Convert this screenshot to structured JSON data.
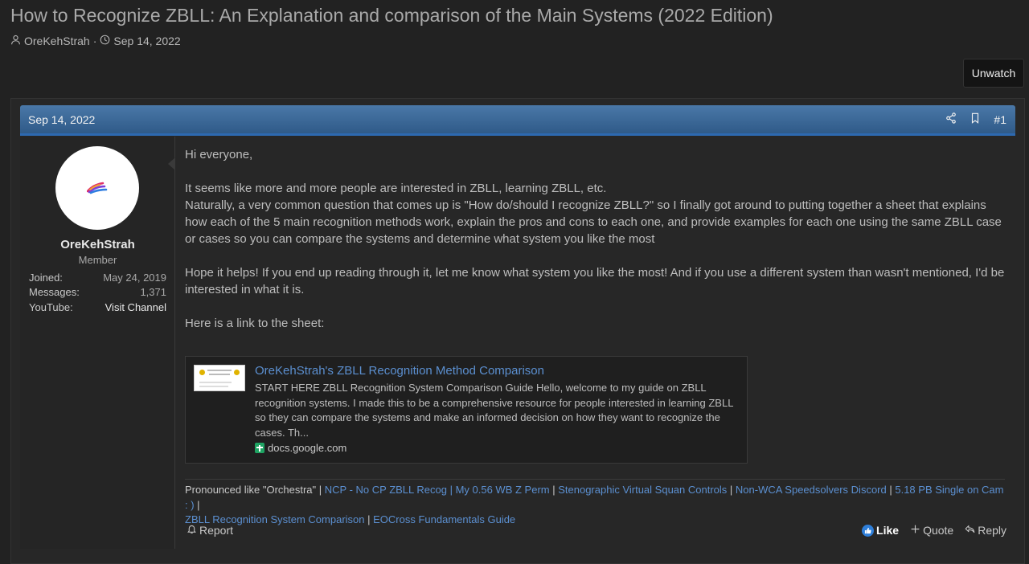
{
  "thread": {
    "title": "How to Recognize ZBLL: An Explanation and comparison of the Main Systems (2022 Edition)",
    "author": "OreKehStrah",
    "separator": "·",
    "date": "Sep 14, 2022",
    "unwatch_label": "Unwatch"
  },
  "post": {
    "date": "Sep 14, 2022",
    "number": "#1",
    "paragraphs": [
      "Hi everyone,",
      "It seems like more and more people are interested in ZBLL, learning ZBLL, etc.",
      "Naturally, a very common question that comes up is \"How do/should I recognize ZBLL?\" so I finally got around to putting together a sheet that explains how each of the 5 main recognition methods work, explain the pros and cons to each one, and provide examples for each one using the same ZBLL case or cases so you can compare the systems and determine what system you like the most",
      "Hope it helps! If you end up reading through it, let me know what system you like the most! And if you use a different system than wasn't mentioned, I'd be interested in what it is.",
      "Here is a link to the sheet:"
    ],
    "unfurl": {
      "title": "OreKehStrah's ZBLL Recognition Method Comparison",
      "description": "START HERE ZBLL Recognition System Comparison Guide Hello, welcome to my guide on ZBLL recognition systems. I made this to be a comprehensive resource for people interested in learning ZBLL so they can compare the systems and make an informed decision on how they want to recognize the cases. Th...",
      "domain": "docs.google.com"
    },
    "signature": {
      "lead": "Pronounced like \"Orchestra\"",
      "sep": " | ",
      "links": [
        "NCP - No CP ZBLL Recog | My 0.56 WB Z Perm",
        "Stenographic Virtual Squan Controls",
        "Non-WCA Speedsolvers Discord",
        "5.18 PB Single on Cam : )",
        "ZBLL Recognition System Comparison",
        "EOCross Fundamentals Guide"
      ]
    },
    "actions": {
      "report": "Report",
      "like": "Like",
      "quote": "Quote",
      "reply": "Reply"
    }
  },
  "user": {
    "name": "OreKehStrah",
    "title": "Member",
    "stats": [
      {
        "label": "Joined:",
        "value": "May 24, 2019"
      },
      {
        "label": "Messages:",
        "value": "1,371"
      },
      {
        "label": "YouTube:",
        "value": "Visit Channel"
      }
    ]
  },
  "colors": {
    "background": "#222222",
    "header_blue": "#3d6a99",
    "link_blue": "#5b8fd0",
    "like_blue": "#2e7ed8"
  },
  "icons": [
    "user-icon",
    "clock-icon",
    "share-icon",
    "bookmark-icon",
    "report-icon",
    "like-icon",
    "plus-icon",
    "reply-icon",
    "google-sheets-icon"
  ]
}
